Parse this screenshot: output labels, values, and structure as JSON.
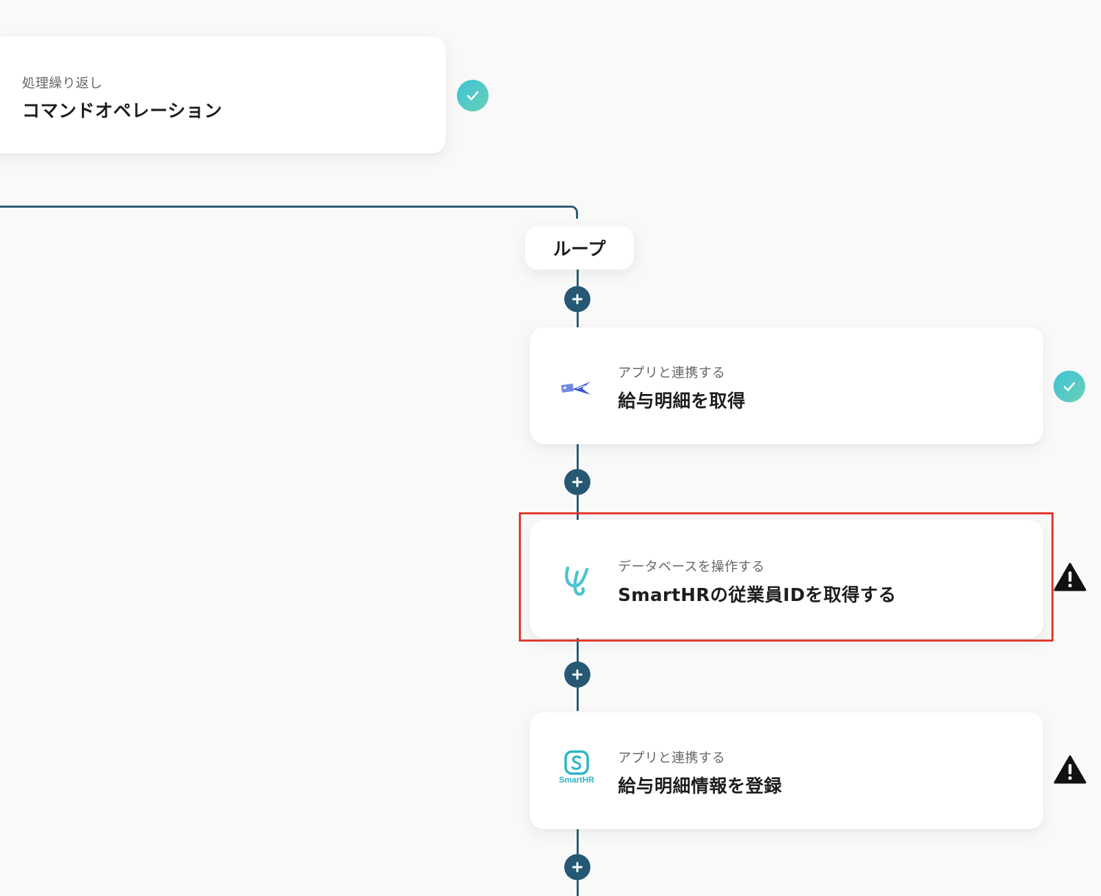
{
  "flow": {
    "loop_step": {
      "subtitle": "処理繰り返し",
      "title": "コマンドオペレーション",
      "status": "success"
    },
    "loop_label": "ループ",
    "steps": [
      {
        "subtitle": "アプリと連携する",
        "title": "給与明細を取得",
        "icon": "payroll-bird-logo-icon",
        "status": "success"
      },
      {
        "subtitle": "データベースを操作する",
        "title": "SmartHRの従業員IDを取得する",
        "icon": "yoom-database-logo-icon",
        "status": "warning",
        "highlighted": true
      },
      {
        "subtitle": "アプリと連携する",
        "title": "給与明細情報を登録",
        "icon": "smarthr-logo-icon",
        "logo_text": "SmartHR",
        "status": "warning"
      }
    ]
  },
  "colors": {
    "connector": "#2b5a73",
    "plus_button": "#265873",
    "success_start": "#3cc3d6",
    "success_end": "#6ad0b6",
    "highlight_border": "#e2382b",
    "smarthr_teal": "#2bb5c7"
  }
}
